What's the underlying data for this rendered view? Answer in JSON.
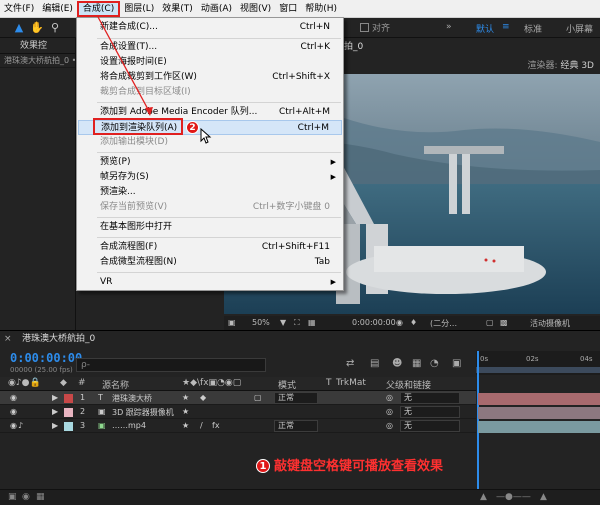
{
  "menubar": {
    "items": [
      "文件(F)",
      "编辑(E)",
      "合成(C)",
      "图层(L)",
      "效果(T)",
      "动画(A)",
      "视图(V)",
      "窗口",
      "帮助(H)"
    ]
  },
  "toolbar": {
    "snap_label": "对齐",
    "workspaces": [
      "默认",
      "标准",
      "小屏幕"
    ]
  },
  "project_panel": {
    "tab": "效果控",
    "row": "港珠澳大桥航拍_0 • 港"
  },
  "viewer": {
    "tab_label": "拍_0",
    "renderer_label": "渲染器:",
    "renderer_value": "经典 3D",
    "zoom": "50%",
    "timecode": "0:00:00:00",
    "quality": "(二分…",
    "camera": "活动摄像机"
  },
  "compose_menu": {
    "items": [
      {
        "label": "新建合成(C)...",
        "shortcut": "Ctrl+N",
        "disabled": false
      },
      {
        "label": "合成设置(T)...",
        "shortcut": "Ctrl+K",
        "disabled": false
      },
      {
        "label": "设置海报时间(E)",
        "shortcut": "",
        "disabled": false
      },
      {
        "label": "将合成裁剪到工作区(W)",
        "shortcut": "Ctrl+Shift+X",
        "disabled": false
      },
      {
        "label": "裁剪合成到目标区域(I)",
        "shortcut": "",
        "disabled": true
      },
      {
        "label": "添加到 Adobe Media Encoder 队列...",
        "shortcut": "Ctrl+Alt+M",
        "disabled": false
      },
      {
        "label": "添加到渲染队列(A)",
        "shortcut": "Ctrl+M",
        "disabled": false
      },
      {
        "label": "添加输出模块(D)",
        "shortcut": "",
        "disabled": true
      },
      {
        "label": "预览(P)",
        "shortcut": "",
        "disabled": false,
        "submenu": true
      },
      {
        "label": "帧另存为(S)",
        "shortcut": "",
        "disabled": false,
        "submenu": true
      },
      {
        "label": "预渲染...",
        "shortcut": "",
        "disabled": false
      },
      {
        "label": "保存当前预览(V)",
        "shortcut": "Ctrl+数字小键盘 0",
        "disabled": true
      },
      {
        "label": "在基本图形中打开",
        "shortcut": "",
        "disabled": false
      },
      {
        "label": "合成流程图(F)",
        "shortcut": "Ctrl+Shift+F11",
        "disabled": false
      },
      {
        "label": "合成微型流程图(N)",
        "shortcut": "Tab",
        "disabled": false
      },
      {
        "label": "VR",
        "shortcut": "",
        "disabled": false,
        "submenu": true
      }
    ],
    "badge_2": "2"
  },
  "timeline": {
    "tab_label": "港珠澳大桥航拍_0",
    "close_glyph": "×",
    "timecode": "0:00:00:00",
    "fps": "00000 (25.00 fps)",
    "search_placeholder": "ρ-",
    "ruler": [
      "0s",
      "02s",
      "04s"
    ],
    "columns": {
      "source_name": "源名称",
      "mode": "模式",
      "t": "T",
      "trkmat": "TrkMat",
      "parent": "父级和链接"
    },
    "layers": [
      {
        "index": "1",
        "type": "T",
        "name": "港珠澳大桥",
        "mode": "正常",
        "parent": "无",
        "label_color": "#c84848",
        "bar_color": "#a86a6e"
      },
      {
        "index": "2",
        "type": "",
        "name": "3D 跟踪器摄像机",
        "mode": "",
        "parent": "无",
        "label_color": "#e8b4c0",
        "bar_color": "#8c7880"
      },
      {
        "index": "3",
        "type": "",
        "name": "……mp4",
        "mode": "正常",
        "parent": "无",
        "label_color": "#a8d8e0",
        "bar_color": "#7a9aa0"
      }
    ]
  },
  "annotation": {
    "badge": "1",
    "text": "敲键盘空格键可播放查看效果"
  }
}
